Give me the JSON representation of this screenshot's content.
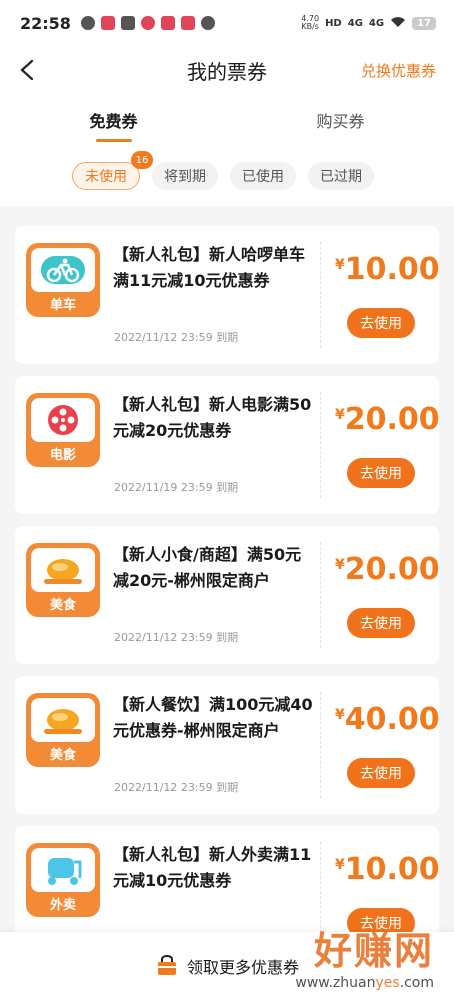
{
  "status_bar": {
    "time": "22:58",
    "net_speed_top": "4.70",
    "net_speed_bottom": "KB/s",
    "signal_1": "4G",
    "signal_2": "4G",
    "battery": "17"
  },
  "header": {
    "title": "我的票券",
    "right_link": "兑换优惠券"
  },
  "tabs": [
    {
      "label": "免费券",
      "active": true
    },
    {
      "label": "购买券",
      "active": false
    }
  ],
  "filters": [
    {
      "label": "未使用",
      "active": true,
      "badge": "16"
    },
    {
      "label": "将到期",
      "active": false
    },
    {
      "label": "已使用",
      "active": false
    },
    {
      "label": "已过期",
      "active": false
    }
  ],
  "coupons": [
    {
      "icon": "bicycle-icon",
      "category": "单车",
      "title": "【新人礼包】新人哈啰单车满11元减10元优惠券",
      "date": "2022/11/12 23:59 到期",
      "currency": "¥",
      "price": "10.00",
      "button": "去使用"
    },
    {
      "icon": "film-reel-icon",
      "category": "电影",
      "title": "【新人礼包】新人电影满50元减20元优惠券",
      "date": "2022/11/19 23:59 到期",
      "currency": "¥",
      "price": "20.00",
      "button": "去使用"
    },
    {
      "icon": "roast-chicken-icon",
      "category": "美食",
      "title": "【新人小食/商超】满50元减20元-郴州限定商户",
      "date": "2022/11/12 23:59 到期",
      "currency": "¥",
      "price": "20.00",
      "button": "去使用"
    },
    {
      "icon": "roast-chicken-icon",
      "category": "美食",
      "title": "【新人餐饮】满100元减40元优惠券-郴州限定商户",
      "date": "2022/11/12 23:59 到期",
      "currency": "¥",
      "price": "40.00",
      "button": "去使用"
    },
    {
      "icon": "scooter-icon",
      "category": "外卖",
      "title": "【新人礼包】新人外卖满11元减10元优惠券",
      "date": "",
      "currency": "¥",
      "price": "10.00",
      "button": "去使用"
    }
  ],
  "bottom_bar": {
    "label": "领取更多优惠券"
  },
  "watermark": {
    "big": "好赚网",
    "small_prefix": "www.zhuan",
    "small_accent": "yes",
    "small_suffix": ".com"
  },
  "colors": {
    "accent": "#f07a1c",
    "icon_bg": "#f38a36"
  }
}
